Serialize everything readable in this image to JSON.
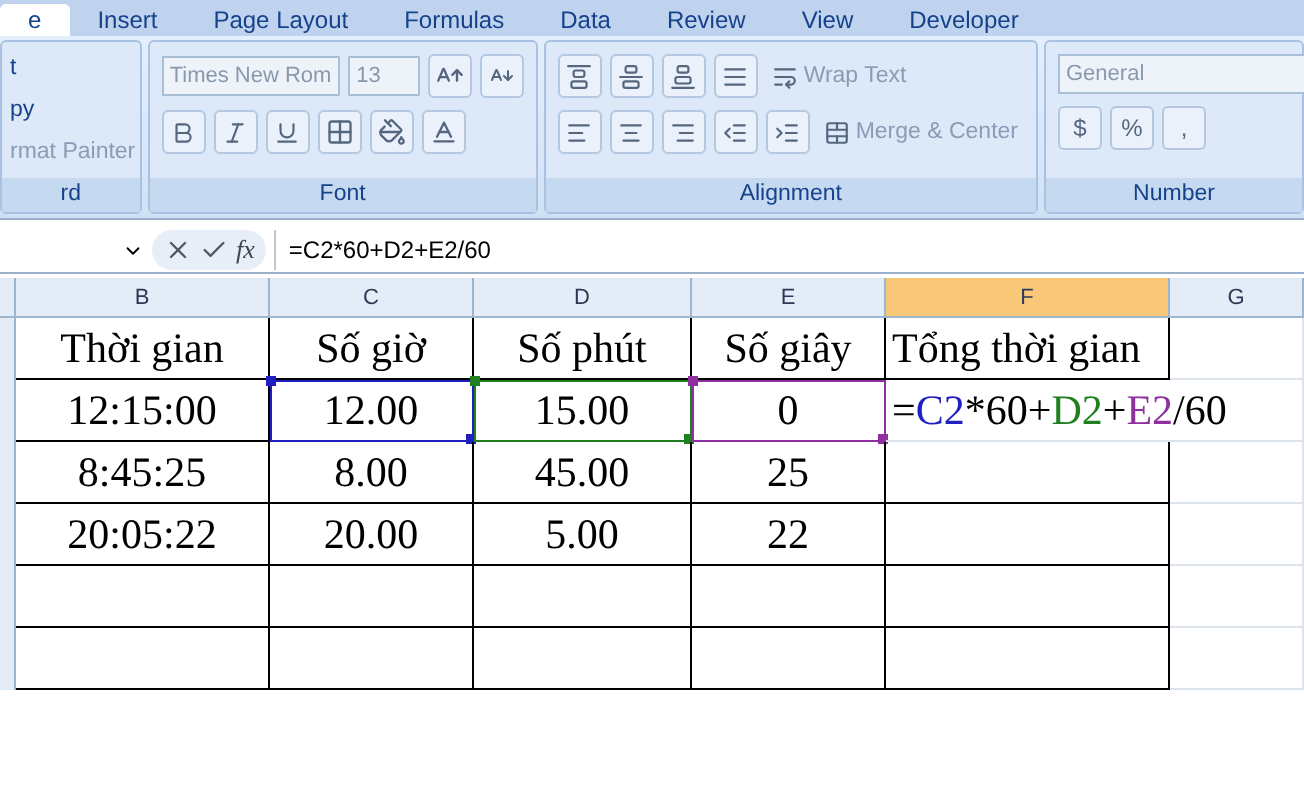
{
  "ribbon_tabs": [
    {
      "label": "e",
      "selected": true
    },
    {
      "label": "Insert",
      "selected": false
    },
    {
      "label": "Page Layout",
      "selected": false
    },
    {
      "label": "Formulas",
      "selected": false
    },
    {
      "label": "Data",
      "selected": false
    },
    {
      "label": "Review",
      "selected": false
    },
    {
      "label": "View",
      "selected": false
    },
    {
      "label": "Developer",
      "selected": false
    }
  ],
  "clipboard": {
    "items": [
      "t",
      "py",
      "rmat Painter"
    ],
    "label": "rd"
  },
  "font_group": {
    "font_name": "Times New Rom",
    "font_size": "13",
    "label": "Font"
  },
  "alignment_group": {
    "wrap_text": "Wrap Text",
    "merge_center": "Merge & Center",
    "label": "Alignment"
  },
  "number_group": {
    "format": "General",
    "buttons": [
      "$",
      "%",
      ","
    ],
    "label": "Number"
  },
  "formula_bar": {
    "function_button": "fx",
    "formula": "=C2*60+D2+E2/60"
  },
  "columns": [
    {
      "label": "B",
      "selected": false
    },
    {
      "label": "C",
      "selected": false
    },
    {
      "label": "D",
      "selected": false
    },
    {
      "label": "E",
      "selected": false
    },
    {
      "label": "F",
      "selected": true
    },
    {
      "label": "G",
      "selected": false
    }
  ],
  "rows": [
    {
      "cells": [
        {
          "text": "Thời gian"
        },
        {
          "text": "Số giờ"
        },
        {
          "text": "Số phút"
        },
        {
          "text": "Số giây"
        },
        {
          "text": "Tổng thời gian"
        },
        {
          "text": ""
        }
      ]
    },
    {
      "cells": [
        {
          "text": "12:15:00"
        },
        {
          "text": "12.00",
          "color": "#2020c0"
        },
        {
          "text": "15.00",
          "color": "#208020"
        },
        {
          "text": "0",
          "color": "#9030a0"
        },
        {
          "kind": "formula",
          "tokens": [
            {
              "text": "=",
              "color": "#000000"
            },
            {
              "text": "C2",
              "color": "#2020c0"
            },
            {
              "text": "*60+",
              "color": "#000000"
            },
            {
              "text": "D2",
              "color": "#208020"
            },
            {
              "text": "+",
              "color": "#000000"
            },
            {
              "text": "E2",
              "color": "#9030a0"
            },
            {
              "text": "/60",
              "color": "#000000"
            }
          ]
        },
        {
          "text": ""
        }
      ]
    },
    {
      "cells": [
        {
          "text": "8:45:25"
        },
        {
          "text": "8.00"
        },
        {
          "text": "45.00"
        },
        {
          "text": "25"
        },
        {
          "text": ""
        },
        {
          "text": ""
        }
      ]
    },
    {
      "cells": [
        {
          "text": "20:05:22"
        },
        {
          "text": "20.00"
        },
        {
          "text": "5.00"
        },
        {
          "text": "22"
        },
        {
          "text": ""
        },
        {
          "text": ""
        }
      ]
    },
    {
      "cells": [
        {
          "text": ""
        },
        {
          "text": ""
        },
        {
          "text": ""
        },
        {
          "text": ""
        },
        {
          "text": ""
        },
        {
          "text": ""
        }
      ]
    },
    {
      "cells": [
        {
          "text": ""
        },
        {
          "text": ""
        },
        {
          "text": ""
        },
        {
          "text": ""
        },
        {
          "text": ""
        },
        {
          "text": ""
        }
      ]
    }
  ]
}
